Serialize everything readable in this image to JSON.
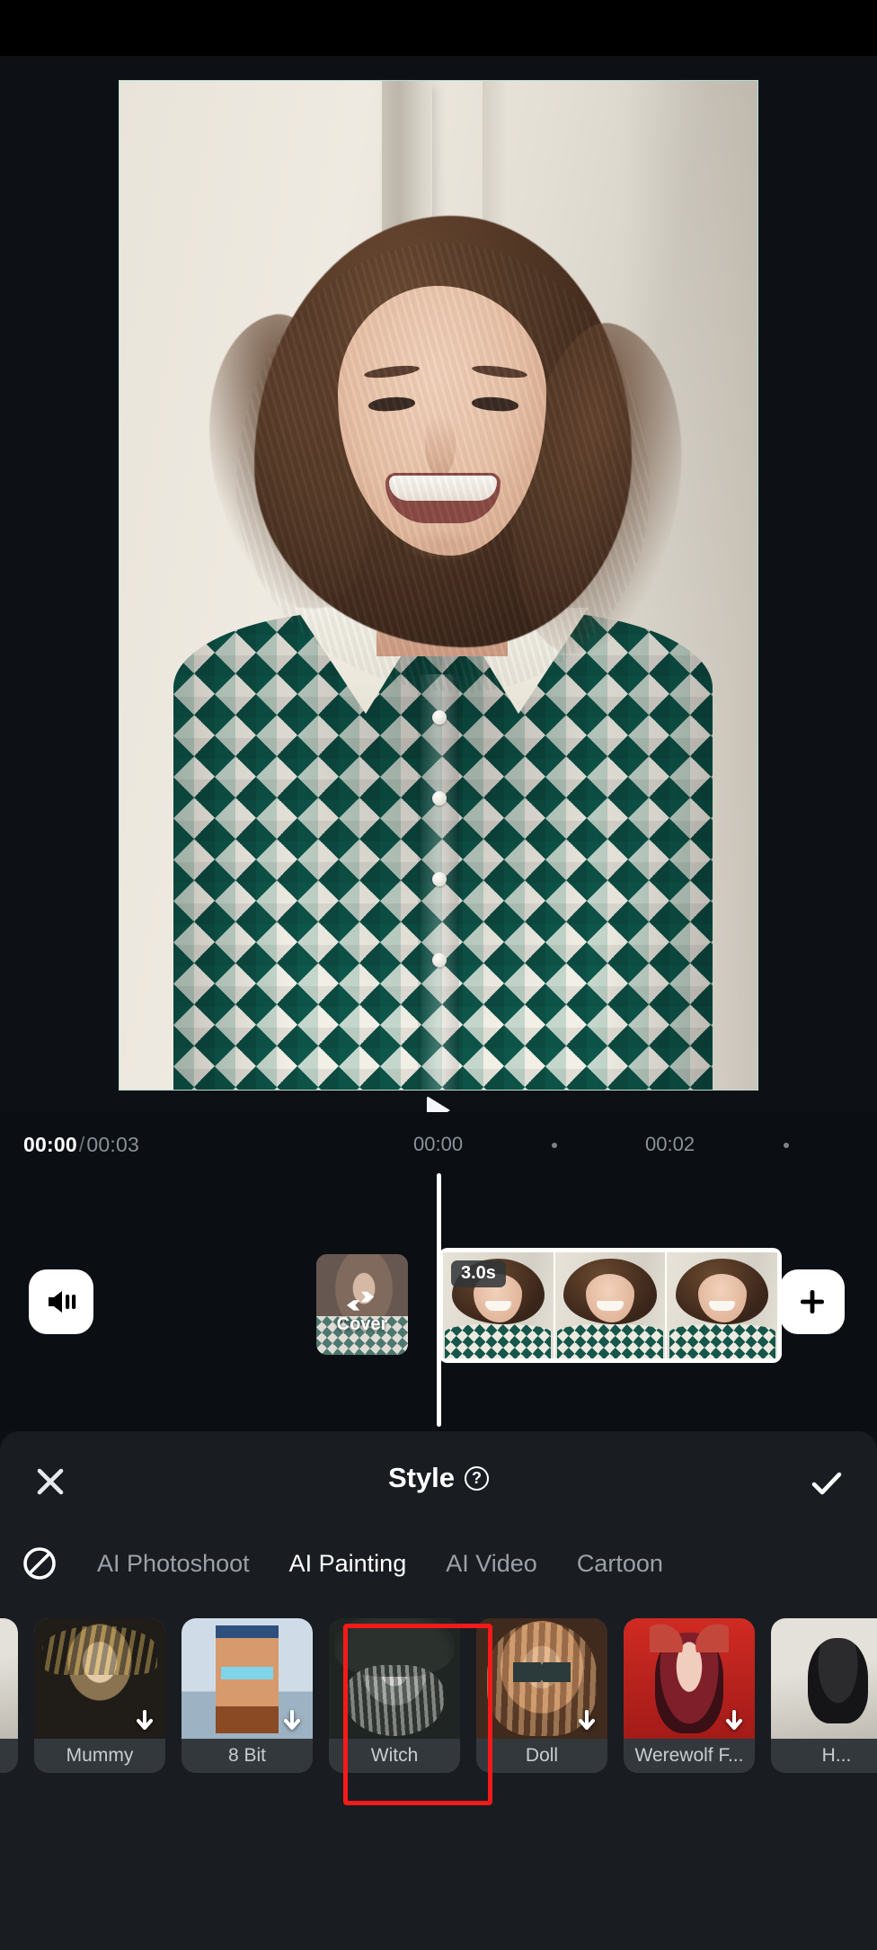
{
  "app": {
    "preview": {
      "play_icon": "play-icon"
    }
  },
  "timeline": {
    "current_time": "00:00",
    "separator": "/",
    "total_time": "00:03",
    "ruler_labels": [
      "00:00",
      "00:02"
    ],
    "audio_icon": "volume-icon",
    "add_icon": "plus-icon",
    "add_label": "+",
    "cover": {
      "label": "Cover",
      "swap_icon": "swap-arrows-icon"
    },
    "clip": {
      "duration_label": "3.0s",
      "frame_count": 3
    }
  },
  "panel": {
    "title": "Style",
    "help_icon": "question-mark-icon",
    "help_glyph": "?",
    "close_icon": "close-icon",
    "done_icon": "checkmark-icon",
    "no_style_icon": "no-style-icon",
    "tabs": [
      {
        "label": "AI Photoshoot",
        "active": false
      },
      {
        "label": "AI Painting",
        "active": true
      },
      {
        "label": "AI Video",
        "active": false
      },
      {
        "label": "Cartoon",
        "active": false
      }
    ],
    "styles": [
      {
        "label": "",
        "art": "art-h",
        "downloadable": false,
        "selected": false,
        "partial": "left"
      },
      {
        "label": "Mummy",
        "art": "art-pharaoh",
        "downloadable": true,
        "selected": false
      },
      {
        "label": "8 Bit",
        "art": "art-8bit",
        "downloadable": true,
        "selected": false
      },
      {
        "label": "Witch",
        "art": "art-witch",
        "downloadable": false,
        "selected": true
      },
      {
        "label": "Doll",
        "art": "art-doll",
        "downloadable": true,
        "selected": false
      },
      {
        "label": "Werewolf F...",
        "art": "art-wolf",
        "downloadable": true,
        "selected": false
      },
      {
        "label": "H...",
        "art": "art-h",
        "downloadable": false,
        "selected": false,
        "partial": "right"
      }
    ],
    "selection_color": "#f51a1a"
  }
}
